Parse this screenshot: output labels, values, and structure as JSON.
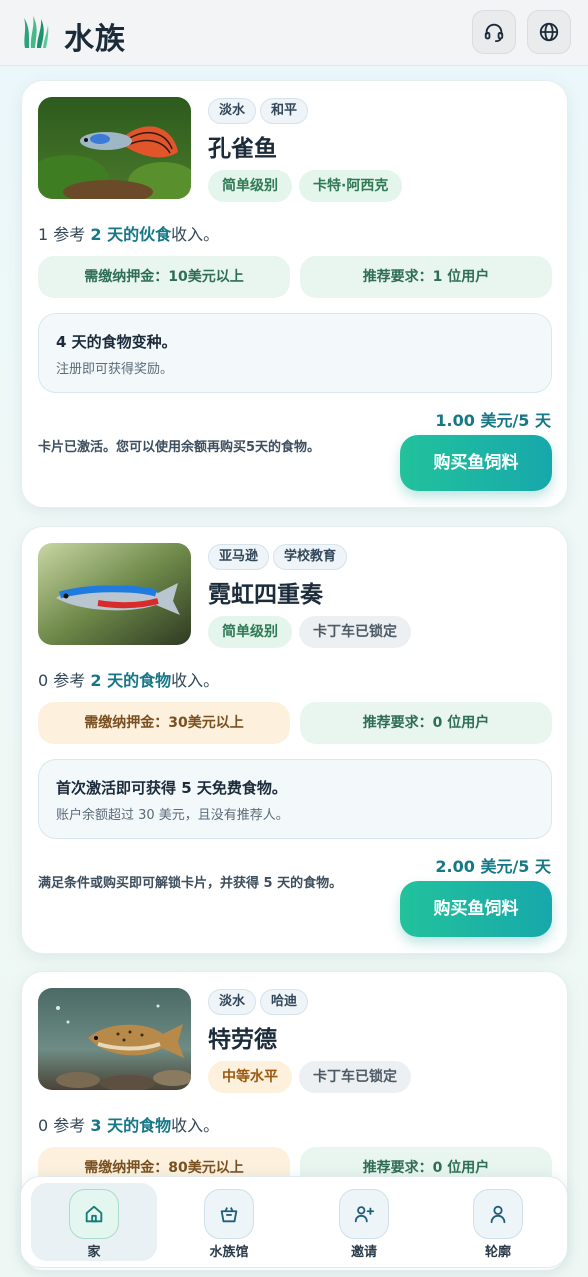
{
  "app": {
    "name": "水族"
  },
  "header": {
    "support_icon": "headset-icon",
    "language_icon": "globe-icon"
  },
  "cards": [
    {
      "tags": [
        "淡水",
        "和平"
      ],
      "title": "孔雀鱼",
      "level": "简单级别",
      "second_pill": "卡特·阿西克",
      "income": {
        "prefix": "1 参考 ",
        "highlight": "2 天的伙食",
        "suffix": "收入。"
      },
      "deposit": "需缴纳押金：10美元以上",
      "referral": "推荐要求：1 位用户",
      "info_title": "4 天的食物变种。",
      "info_sub": "注册即可获得奖励。",
      "price": "1.00 美元/5 天",
      "status": "卡片已激活。您可以使用余额再购买5天的食物。",
      "button": "购买鱼饲料"
    },
    {
      "tags": [
        "亚马逊",
        "学校教育"
      ],
      "title": "霓虹四重奏",
      "level": "简单级别",
      "second_pill": "卡丁车已锁定",
      "income": {
        "prefix": "0 参考 ",
        "highlight": "2 天的食物",
        "suffix": "收入。"
      },
      "deposit": "需缴纳押金：30美元以上",
      "referral": "推荐要求：0 位用户",
      "info_title": "首次激活即可获得 5 天免费食物。",
      "info_sub": "账户余额超过 30 美元，且没有推荐人。",
      "price": "2.00 美元/5 天",
      "status": "满足条件或购买即可解锁卡片，并获得 5 天的食物。",
      "button": "购买鱼饲料"
    },
    {
      "tags": [
        "淡水",
        "哈迪"
      ],
      "title": "特劳德",
      "level": "中等水平",
      "second_pill": "卡丁车已锁定",
      "income": {
        "prefix": "0 参考 ",
        "highlight": "3 天的食物",
        "suffix": "收入。"
      },
      "deposit": "需缴纳押金：80美元以上",
      "referral": "推荐要求：0 位用户"
    }
  ],
  "nav": [
    {
      "label": "家",
      "icon": "home-icon",
      "active": true
    },
    {
      "label": "水族馆",
      "icon": "basket-icon",
      "active": false
    },
    {
      "label": "邀请",
      "icon": "add-user-icon",
      "active": false
    },
    {
      "label": "轮廓",
      "icon": "user-icon",
      "active": false
    }
  ],
  "colors": {
    "accent": "#167786",
    "button_start": "#22c29c",
    "button_end": "#17a8ab"
  }
}
